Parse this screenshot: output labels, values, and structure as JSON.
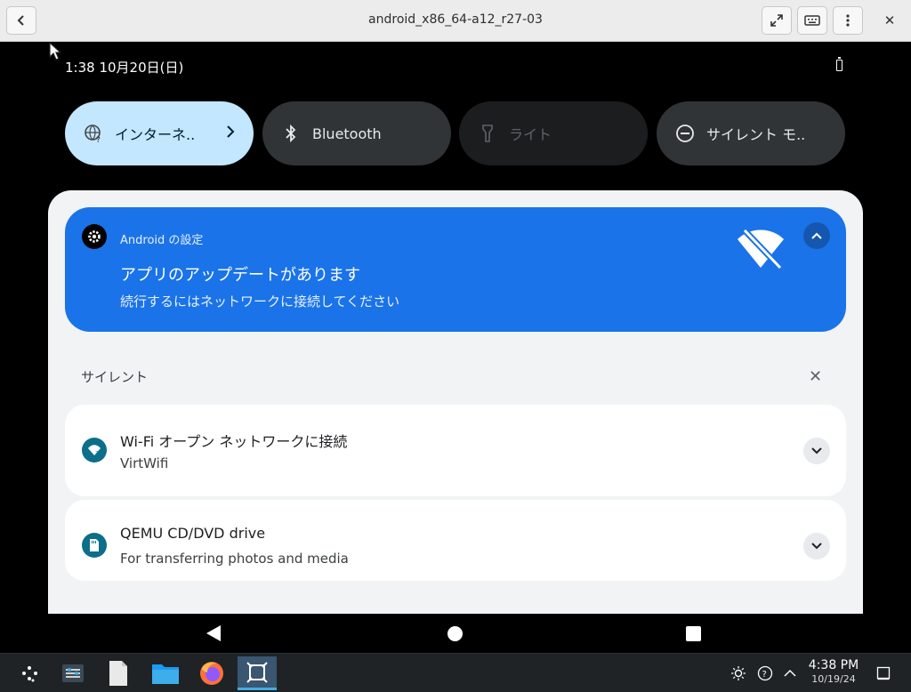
{
  "window": {
    "title": "android_x86_64-a12_r27-03",
    "buttons": {
      "back": "back-icon",
      "fullscreen": "expand-icon",
      "keyboard": "keyboard-icon",
      "menu": "kebab-menu-icon",
      "close": "✕"
    }
  },
  "status_bar": {
    "datetime": "1:38 10月20日(日)",
    "battery_icon": "battery-icon"
  },
  "quick_settings": [
    {
      "label": "インターネ..",
      "icon": "internet-icon",
      "state": "on"
    },
    {
      "label": "Bluetooth",
      "icon": "bluetooth-icon",
      "state": "off"
    },
    {
      "label": "ライト",
      "icon": "flashlight-icon",
      "state": "unavailable"
    },
    {
      "label": "サイレント モ..",
      "icon": "do-not-disturb-icon",
      "state": "off"
    }
  ],
  "notifications": {
    "highlighted": {
      "app": "Android の設定",
      "title": "アプリのアップデートがあります",
      "text": "続行するにはネットワークに接続してください",
      "icon": "gear-icon",
      "image": "wifi-off-icon",
      "color": "#1a73e8"
    },
    "section_label": "サイレント",
    "section_clear": "✕",
    "items": [
      {
        "title": "Wi-Fi オープン ネットワークに接続",
        "text": "VirtWifi",
        "icon": "wifi-question-icon"
      },
      {
        "title": "QEMU CD/DVD drive",
        "text": "For transferring photos and media",
        "icon": "sd-card-icon"
      }
    ]
  },
  "taskbar": {
    "items": [
      "app-launcher-icon",
      "settings-icon",
      "text-editor-icon",
      "file-manager-icon",
      "firefox-icon",
      "android-emulator-icon"
    ],
    "tray": [
      "brightness-icon",
      "network-icon",
      "tray-expand-icon"
    ],
    "clock_time": "4:38 PM",
    "clock_date": "10/19/24"
  }
}
